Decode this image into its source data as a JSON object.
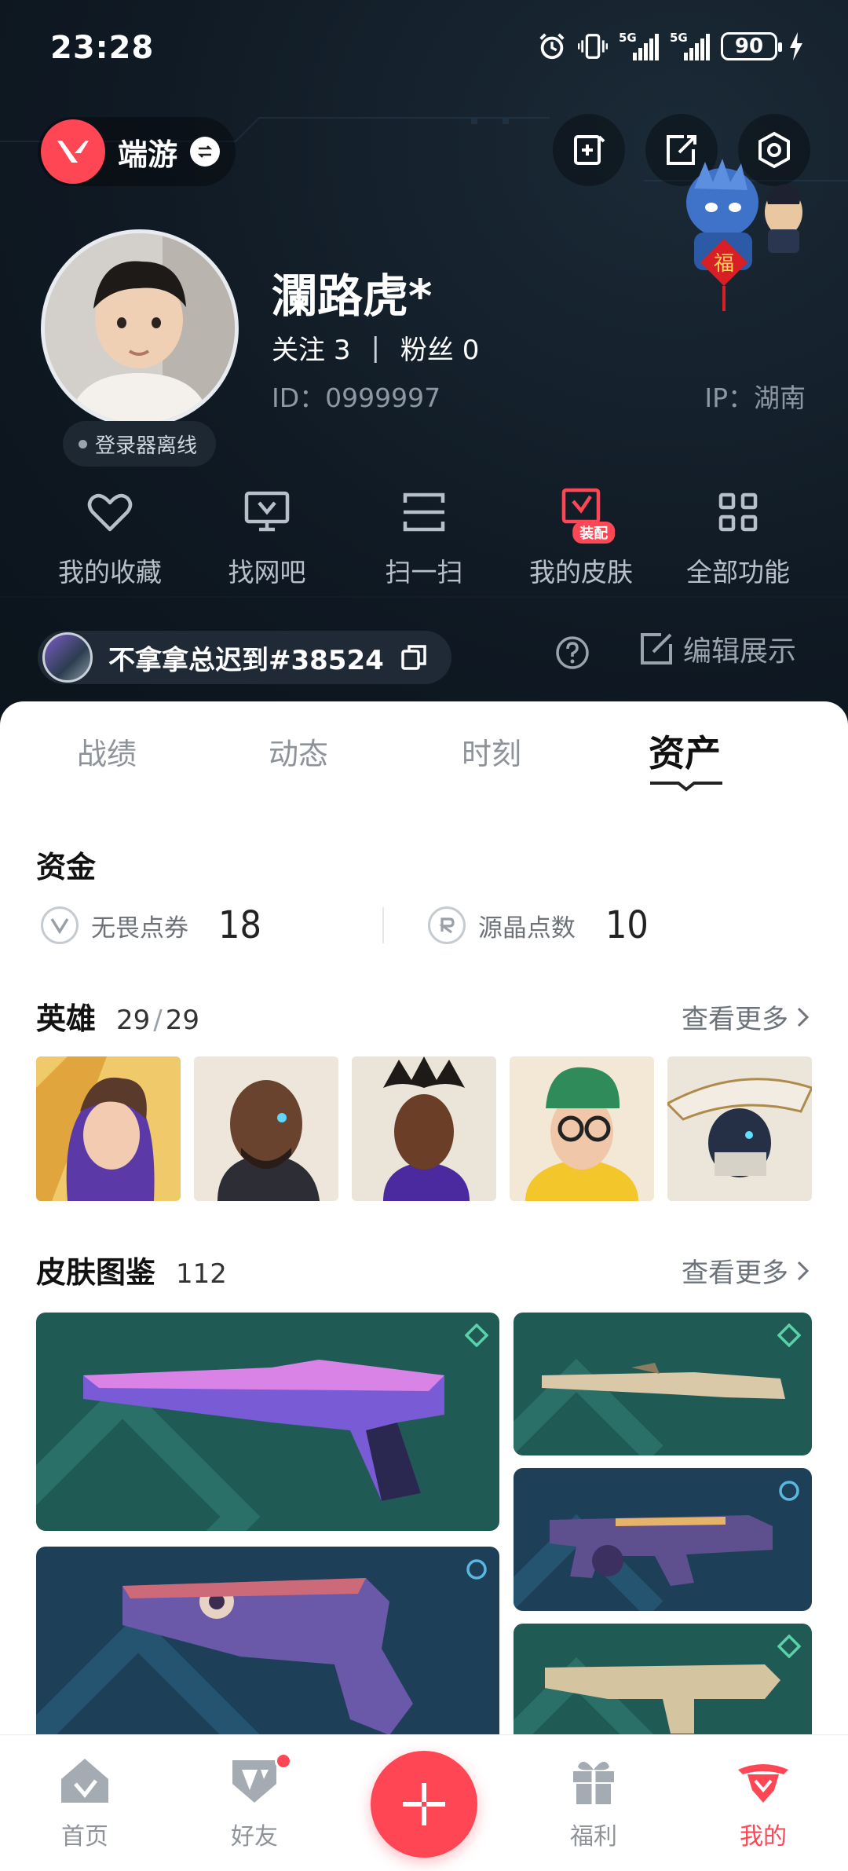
{
  "status_bar": {
    "time": "23:28",
    "network_1": "5G",
    "network_2": "5G",
    "battery": "90"
  },
  "header": {
    "game_name": "端游"
  },
  "profile": {
    "nickname": "瀾路虎*",
    "follow_label": "关注",
    "follow_count": "3",
    "separator": "|",
    "fans_label": "粉丝",
    "fans_count": "0",
    "id_text": "ID：0999997",
    "ip_text": "IP：湖南",
    "status": "登录器离线"
  },
  "shortcuts": [
    {
      "label": "我的收藏",
      "icon": "heart-icon"
    },
    {
      "label": "找网吧",
      "icon": "monitor-icon"
    },
    {
      "label": "扫一扫",
      "icon": "scan-icon"
    },
    {
      "label": "我的皮肤",
      "icon": "skin-icon",
      "badge": "装配"
    },
    {
      "label": "全部功能",
      "icon": "grid-icon"
    }
  ],
  "game_tag": {
    "text": "不拿拿总迟到#38524"
  },
  "edit_label": "编辑展示",
  "tabs": [
    {
      "label": "战绩",
      "active": false
    },
    {
      "label": "动态",
      "active": false
    },
    {
      "label": "时刻",
      "active": false
    },
    {
      "label": "资产",
      "active": true
    }
  ],
  "funds": {
    "title": "资金",
    "items": [
      {
        "label": "无畏点券",
        "value": "18"
      },
      {
        "label": "源晶点数",
        "value": "10"
      }
    ]
  },
  "heroes": {
    "title": "英雄",
    "owned": "29",
    "total": "29",
    "more": "查看更多"
  },
  "skins": {
    "title": "皮肤图鉴",
    "count": "112",
    "more": "查看更多"
  },
  "bottom_nav": [
    {
      "label": "首页",
      "active": false
    },
    {
      "label": "好友",
      "active": false
    },
    {
      "label": "福利",
      "active": false
    },
    {
      "label": "我的",
      "active": true
    }
  ],
  "colors": {
    "accent": "#ff4655",
    "hero_bg": "#101a24",
    "skin_teal": "#1f5a55",
    "skin_blue": "#1d3f57"
  }
}
